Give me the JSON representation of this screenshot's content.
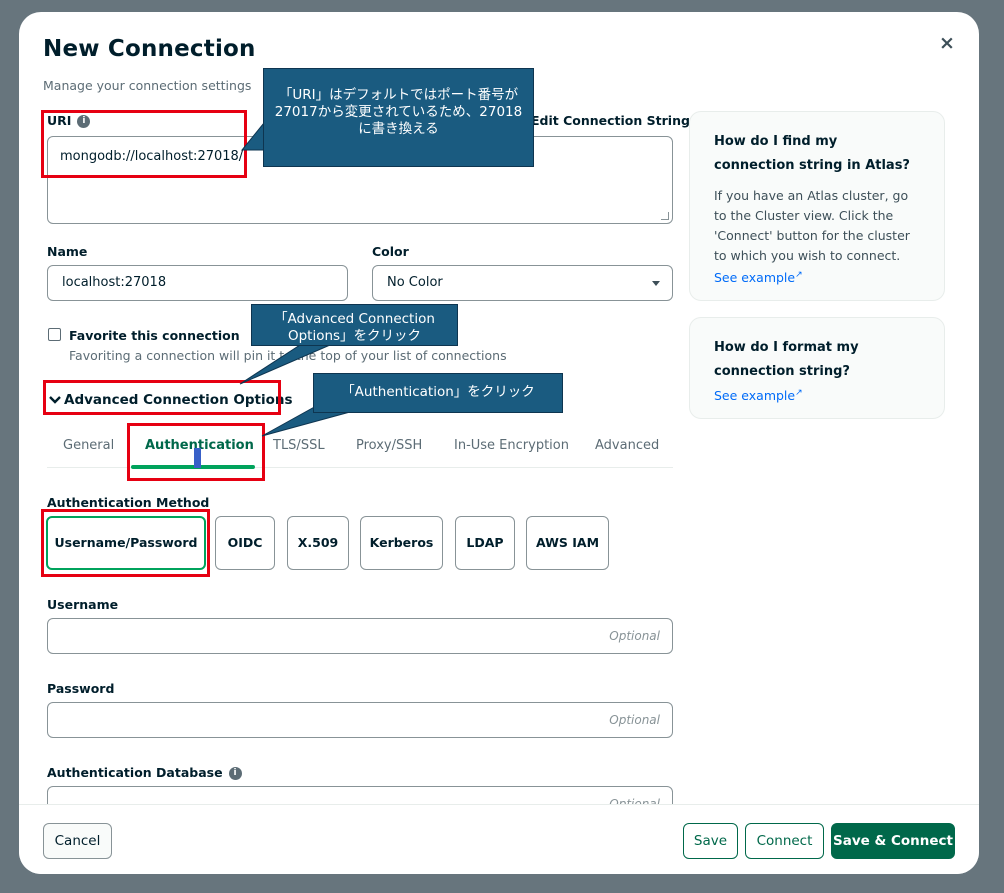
{
  "modal": {
    "title": "New Connection",
    "subtitle": "Manage your connection settings",
    "close_glyph": "×"
  },
  "uri": {
    "label": "URI",
    "info_glyph": "i",
    "value": "mongodb://localhost:27018/",
    "toggle_label": "Edit Connection String",
    "toggle_on": true
  },
  "name": {
    "label": "Name",
    "value": "localhost:27018"
  },
  "color": {
    "label": "Color",
    "value": "No Color"
  },
  "favorite": {
    "label": "Favorite this connection",
    "description": "Favoriting a connection will pin it to the top of your list of connections"
  },
  "advanced": {
    "toggle_label": "Advanced Connection Options",
    "tabs": [
      "General",
      "Authentication",
      "TLS/SSL",
      "Proxy/SSH",
      "In-Use Encryption",
      "Advanced"
    ],
    "active_tab": "Authentication"
  },
  "auth": {
    "method_label": "Authentication Method",
    "methods": [
      "Username/Password",
      "OIDC",
      "X.509",
      "Kerberos",
      "LDAP",
      "AWS IAM"
    ],
    "selected_method": "Username/Password",
    "username_label": "Username",
    "password_label": "Password",
    "auth_db_label": "Authentication Database",
    "optional_placeholder": "Optional"
  },
  "footer": {
    "cancel": "Cancel",
    "save": "Save",
    "connect": "Connect",
    "save_connect": "Save & Connect"
  },
  "help": [
    {
      "title": "How do I find my connection string in Atlas?",
      "text": "If you have an Atlas cluster, go to the Cluster view. Click the 'Connect' button for the cluster to which you wish to connect.",
      "link": "See example"
    },
    {
      "title": "How do I format my connection string?",
      "link": "See example"
    }
  ],
  "annotations": {
    "uri_note": "「URI」はデフォルトではポート番号が27017から変更されているため、27018に書き換える",
    "advanced_note": "「Advanced Connection Options」をクリック",
    "auth_note": "「Authentication」をクリック"
  },
  "colors": {
    "accent_green": "#00684a",
    "selected_border": "#00a35c",
    "toggle_blue": "#016bf8",
    "annotation_red": "#e60012",
    "callout_blue": "#1a5b80"
  }
}
